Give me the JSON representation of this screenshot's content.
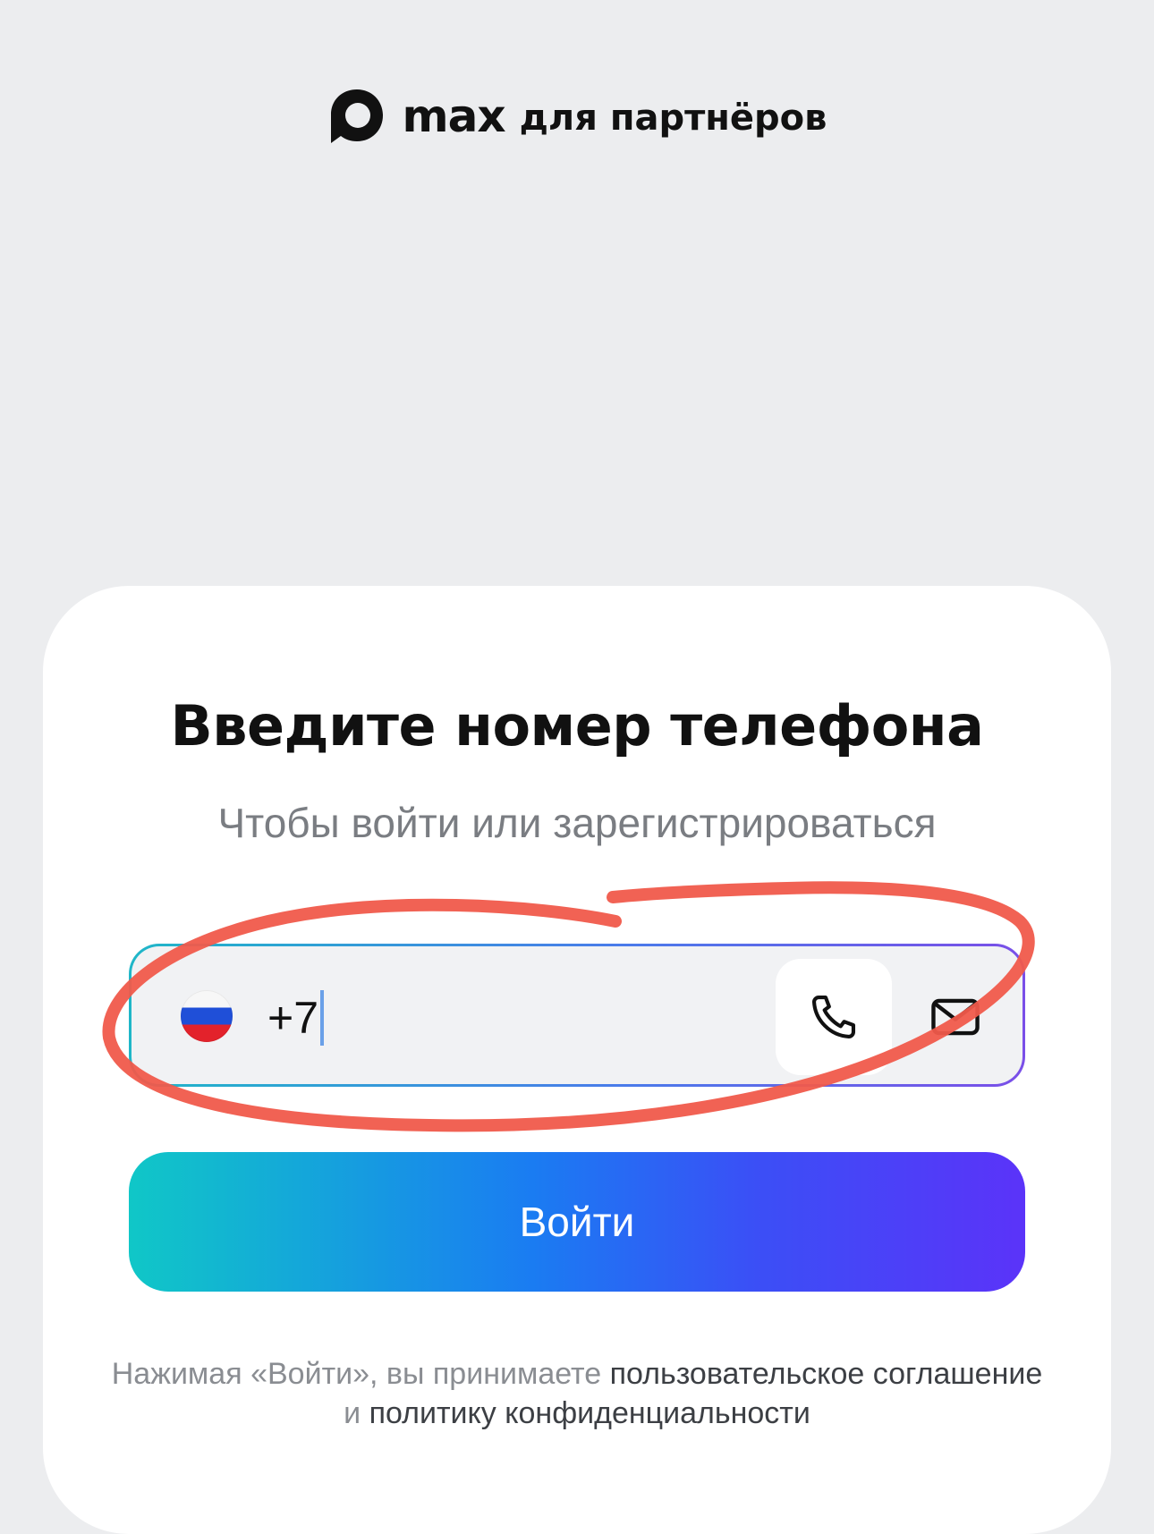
{
  "brand": {
    "wordmark": "max",
    "subtitle": "для партнёров"
  },
  "login": {
    "title": "Введите номер телефона",
    "subtitle": "Чтобы войти или зарегистрироваться",
    "phone": {
      "country_flag": "russia-flag-icon",
      "value": "+7"
    },
    "modes": [
      "phone-icon",
      "mail-icon"
    ],
    "submit_label": "Войти",
    "legal": {
      "prefix": "Нажимая «Войти», вы принимаете ",
      "terms_link": "пользовательское соглашение",
      "joiner": " и ",
      "privacy_link": "политику конфиденциальности"
    }
  },
  "colors": {
    "annotation": "#F05A4B",
    "button_gradient": [
      "#10C7C7",
      "#1A7CF2",
      "#5B33F9"
    ],
    "background": "#ECEDEF"
  }
}
